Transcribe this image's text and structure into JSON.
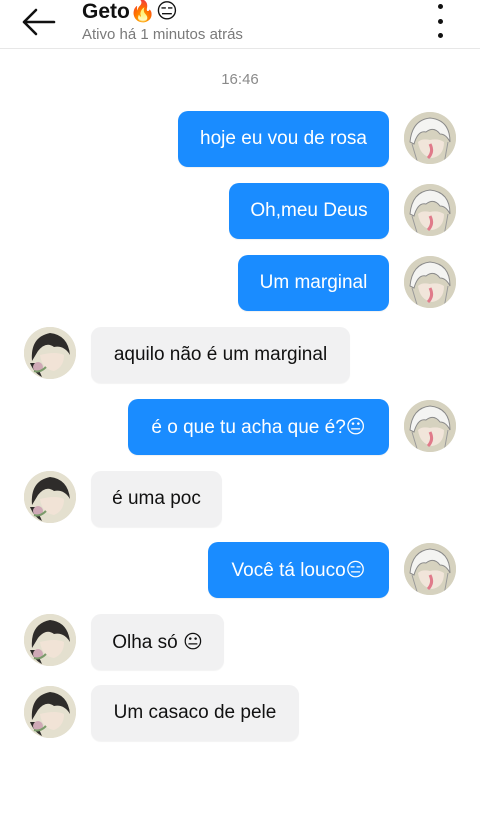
{
  "header": {
    "contact_name": "Geto🔥😑",
    "status": "Ativo há 1 minutos atrás"
  },
  "timestamp": "16:46",
  "messages": [
    {
      "text": "hoje eu vou de rosa",
      "side": "outgoing"
    },
    {
      "text": "Oh,meu Deus",
      "side": "outgoing"
    },
    {
      "text": "Um marginal",
      "side": "outgoing"
    },
    {
      "text": "aquilo não é um marginal",
      "side": "incoming"
    },
    {
      "text": "é o que tu acha que é?😐",
      "side": "outgoing"
    },
    {
      "text": "é uma poc",
      "side": "incoming"
    },
    {
      "text": "Você tá louco😑",
      "side": "outgoing"
    },
    {
      "text": "Olha só 😐",
      "side": "incoming"
    },
    {
      "text": "Um casaco de pele",
      "side": "incoming"
    }
  ],
  "icons": {
    "back": "arrow-left-icon",
    "more": "more-vertical-icon",
    "outgoing_avatar": "white-haired-character-avatar",
    "incoming_avatar": "dark-haired-character-avatar"
  },
  "colors": {
    "outgoing_bubble": "#1a8cff",
    "incoming_bubble": "#f1f1f2",
    "muted_text": "#7a7a7a"
  }
}
